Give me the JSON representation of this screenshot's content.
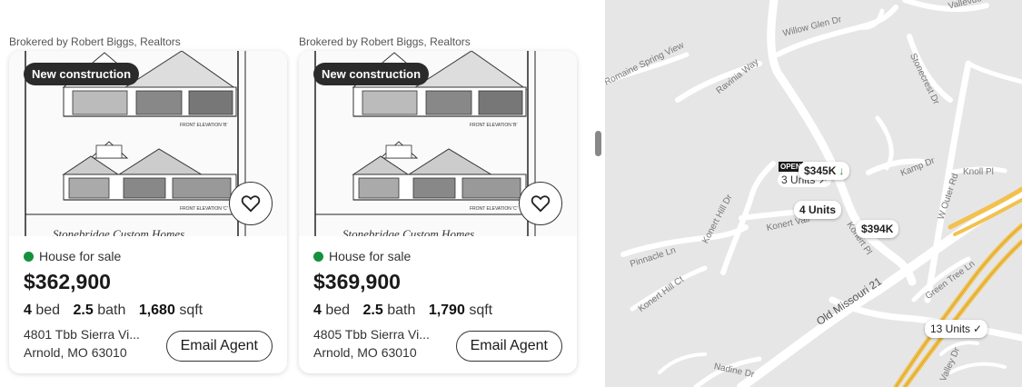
{
  "listings": [
    {
      "broker": "Brokered by Robert Biggs, Realtors",
      "badge": "New construction",
      "status": "House for sale",
      "price": "$362,900",
      "beds": "4",
      "beds_label": "bed",
      "baths": "2.5",
      "baths_label": "bath",
      "sqft": "1,680",
      "sqft_label": "sqft",
      "address_line1": "4801 Tbb Sierra Vi...",
      "address_line2": "Arnold, MO 63010",
      "email_label": "Email Agent",
      "elevation_top": "FRONT ELEVATION 'B'",
      "elevation_bottom": "FRONT ELEVATION 'C'",
      "plan_caption": "Stonebridge Custom Homes"
    },
    {
      "broker": "Brokered by Robert Biggs, Realtors",
      "badge": "New construction",
      "status": "House for sale",
      "price": "$369,900",
      "beds": "4",
      "beds_label": "bed",
      "baths": "2.5",
      "baths_label": "bath",
      "sqft": "1,790",
      "sqft_label": "sqft",
      "address_line1": "4805 Tbb Sierra Vi...",
      "address_line2": "Arnold, MO 63010",
      "email_label": "Email Agent",
      "elevation_top": "FRONT ELEVATION 'B'",
      "elevation_bottom": "FRONT ELEVATION 'C'",
      "plan_caption": "Stonebridge Custom Homes"
    }
  ],
  "map": {
    "pins": {
      "open_badge": "OPEN",
      "pin_345": "$345K",
      "pin_345_arrow": "↓",
      "units_3": "3 Units",
      "units_3_mark": "↗",
      "units_4": "4 Units",
      "pin_394": "$394K",
      "units_13": "13 Units",
      "units_13_check": "✓"
    },
    "streets": {
      "vallevue": "Vallevue Dr",
      "willow_glen": "Willow Glen Dr",
      "romaine_spring": "Romaine Spring View",
      "ravinia": "Ravinia Way",
      "stonecrest": "Stonecrest Dr",
      "kamp": "Kamp Dr",
      "knoll": "Knoll Pl",
      "w_outer": "W Outer Rd",
      "konert_hill_dr": "Konert Hill Dr",
      "konert_valley": "Konert Vall",
      "konert_pl": "Konert Pl",
      "pinnacle": "Pinnacle Ln",
      "konert_hill_ct": "Konert Hill Ct",
      "old_missouri": "Old Missouri 21",
      "green_tree": "Green Tree Ln",
      "nadine": "Nadine Dr",
      "valley_dr": "Valley Dr"
    },
    "colors": {
      "background": "#e6e6e6",
      "road": "#ffffff",
      "highway": "#f2c14e",
      "open_green": "#16903c"
    }
  }
}
